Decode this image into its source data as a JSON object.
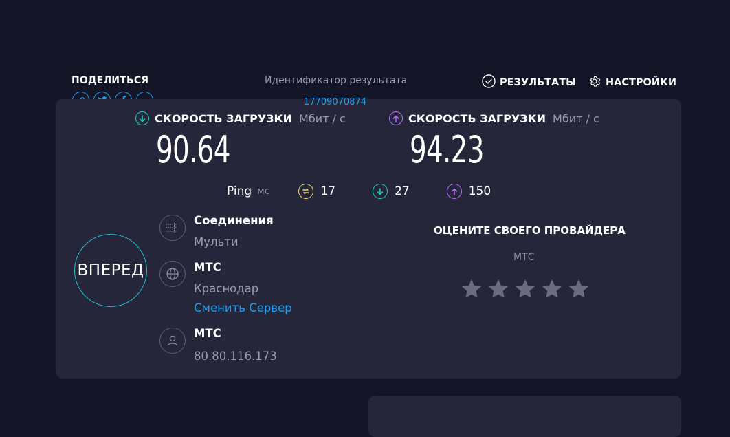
{
  "share": {
    "label": "ПОДЕЛИТЬСЯ",
    "icons": [
      "link-icon",
      "twitter-icon",
      "facebook-icon",
      "more-icon"
    ]
  },
  "result": {
    "label": "Идентификатор результата",
    "id": "17709070874"
  },
  "nav": {
    "results": "РЕЗУЛЬТАТЫ",
    "settings": "НАСТРОЙКИ"
  },
  "download": {
    "label": "СКОРОСТЬ ЗАГРУЗКИ",
    "unit": "Мбит / с",
    "value": "90.64"
  },
  "upload": {
    "label": "СКОРОСТЬ ЗАГРУЗКИ",
    "unit": "Мбит / с",
    "value": "94.23"
  },
  "ping": {
    "label": "Ping",
    "unit": "мс",
    "jitter": "17",
    "download": "27",
    "upload": "150"
  },
  "go_button": "ВПЕРЕД",
  "connections": {
    "title": "Соединения",
    "value": "Мульти"
  },
  "server": {
    "title": "МТС",
    "city": "Краснодар",
    "change_link": "Сменить Сервер"
  },
  "client": {
    "title": "МТС",
    "ip": "80.80.116.173"
  },
  "rating": {
    "title": "ОЦЕНИТЕ СВОЕГО ПРОВАЙДЕРА",
    "provider": "МТС",
    "stars_total": 5,
    "stars_filled": 0
  },
  "colors": {
    "background": "#141526",
    "card": "#25263a",
    "accent_blue": "#1f9eef",
    "download_teal": "#1fd1c2",
    "upload_purple": "#b86bff",
    "ping_yellow": "#f5d76e",
    "muted": "#9a9bb2",
    "star": "#6b6c80"
  }
}
